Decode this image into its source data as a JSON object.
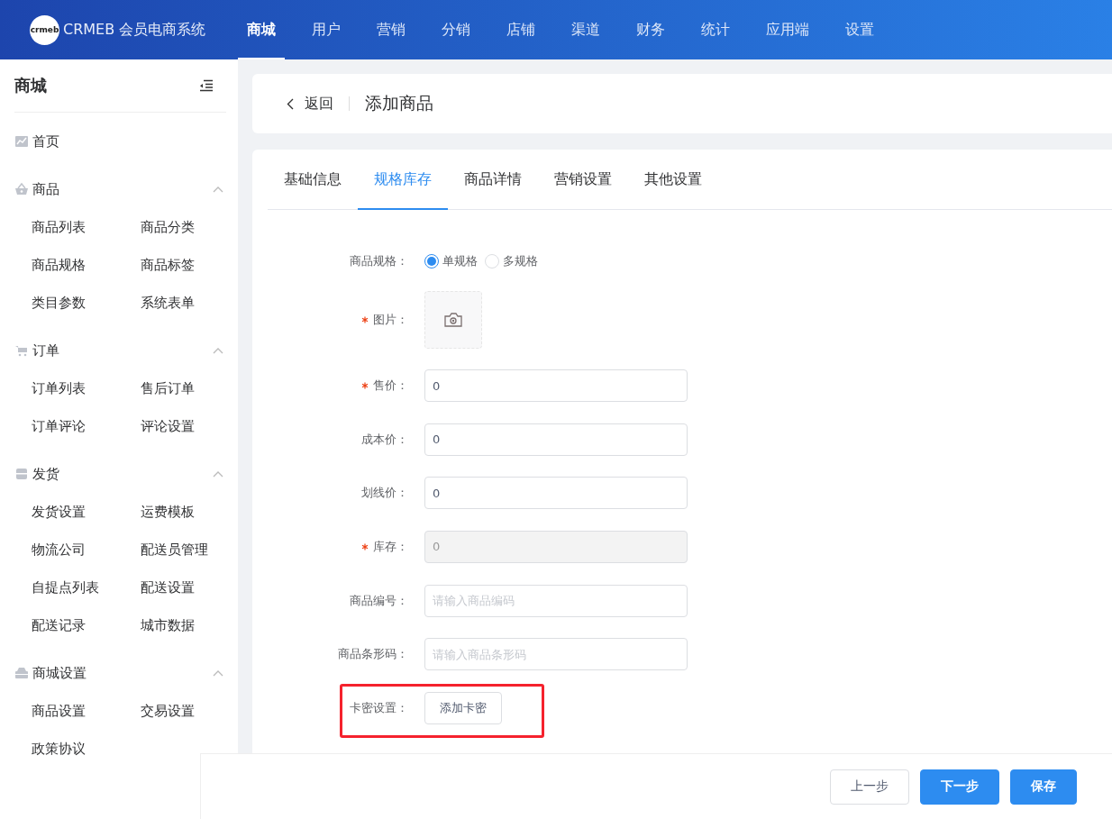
{
  "header": {
    "brand": "CRMEB 会员电商系统",
    "logo_text": "crmeb",
    "nav": [
      {
        "label": "商城",
        "selected": true
      },
      {
        "label": "用户",
        "selected": false
      },
      {
        "label": "营销",
        "selected": false
      },
      {
        "label": "分销",
        "selected": false
      },
      {
        "label": "店铺",
        "selected": false
      },
      {
        "label": "渠道",
        "selected": false
      },
      {
        "label": "财务",
        "selected": false
      },
      {
        "label": "统计",
        "selected": false
      },
      {
        "label": "应用端",
        "selected": false
      },
      {
        "label": "设置",
        "selected": false
      }
    ]
  },
  "sidebar": {
    "title": "商城",
    "groups": [
      {
        "label": "首页",
        "kind": "link"
      },
      {
        "label": "商品",
        "kind": "group",
        "expanded": true,
        "items": [
          "商品列表",
          "商品分类",
          "商品规格",
          "商品标签",
          "类目参数",
          "系统表单"
        ]
      },
      {
        "label": "订单",
        "kind": "group",
        "expanded": true,
        "items": [
          "订单列表",
          "售后订单",
          "订单评论",
          "评论设置"
        ]
      },
      {
        "label": "发货",
        "kind": "group",
        "expanded": true,
        "items": [
          "发货设置",
          "运费模板",
          "物流公司",
          "配送员管理",
          "自提点列表",
          "配送设置",
          "配送记录",
          "城市数据"
        ]
      },
      {
        "label": "商城设置",
        "kind": "group",
        "expanded": true,
        "items": [
          "商品设置",
          "交易设置",
          "政策协议"
        ]
      }
    ]
  },
  "page_header": {
    "back": "返回",
    "title": "添加商品"
  },
  "tabs": [
    {
      "label": "基础信息",
      "selected": false
    },
    {
      "label": "规格库存",
      "selected": true
    },
    {
      "label": "商品详情",
      "selected": false
    },
    {
      "label": "营销设置",
      "selected": false
    },
    {
      "label": "其他设置",
      "selected": false
    }
  ],
  "form": [
    {
      "kind": "radio",
      "label": "商品规格：",
      "required": false,
      "options": [
        {
          "label": "单规格",
          "selected": true
        },
        {
          "label": "多规格",
          "selected": false
        }
      ]
    },
    {
      "kind": "upload",
      "label": "图片：",
      "required": true
    },
    {
      "kind": "input",
      "label": "售价：",
      "required": true,
      "value": "0",
      "disabled": false
    },
    {
      "kind": "input",
      "label": "成本价：",
      "required": false,
      "value": "0",
      "disabled": false
    },
    {
      "kind": "input",
      "label": "划线价：",
      "required": false,
      "value": "0",
      "disabled": false
    },
    {
      "kind": "input",
      "label": "库存：",
      "required": true,
      "value": "0",
      "disabled": true
    },
    {
      "kind": "input",
      "label": "商品编号：",
      "required": false,
      "placeholder": "请输入商品编码",
      "disabled": false
    },
    {
      "kind": "input",
      "label": "商品条形码：",
      "required": false,
      "placeholder": "请输入商品条形码",
      "disabled": false
    },
    {
      "kind": "button",
      "label": "卡密设置：",
      "required": false,
      "button": "添加卡密",
      "highlighted": true
    }
  ],
  "footer": {
    "buttons": [
      {
        "label": "上一步",
        "kind": "default"
      },
      {
        "label": "下一步",
        "kind": "primary"
      },
      {
        "label": "保存",
        "kind": "primary"
      }
    ]
  }
}
